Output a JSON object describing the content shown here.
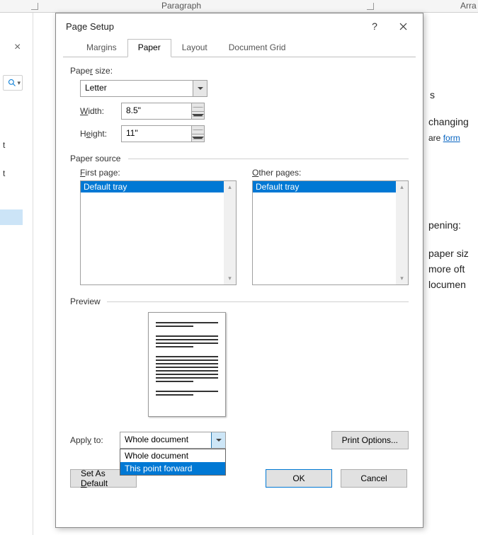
{
  "background": {
    "ribbon_group_paragraph": "Paragraph",
    "ribbon_group_arrange": "Arra",
    "pane_item_1": "t",
    "pane_item_2": "t",
    "doc_text_1": "s",
    "doc_text_2": "changing",
    "doc_text_3_plain": "are ",
    "doc_text_3_link": "form",
    "doc_text_4": "pening:",
    "doc_text_5": "paper siz",
    "doc_text_6": "more oft",
    "doc_text_7": "locumen"
  },
  "dialog": {
    "title": "Page Setup",
    "tabs": {
      "margins": "Margins",
      "paper": "Paper",
      "layout": "Layout",
      "grid": "Document Grid"
    },
    "paper_size_label": "Paper size:",
    "paper_size_value": "Letter",
    "width_label": "Width:",
    "width_value": "8.5\"",
    "height_label": "Height:",
    "height_value": "11\"",
    "paper_source_label": "Paper source",
    "first_page_label": "First page:",
    "other_pages_label": "Other pages:",
    "tray_option": "Default tray",
    "preview_label": "Preview",
    "apply_to_label": "Apply to:",
    "apply_to_value": "Whole document",
    "apply_options": [
      "Whole document",
      "This point forward"
    ],
    "apply_selected_index": 1,
    "print_options_label": "Print Options...",
    "set_default_label": "Set As Default",
    "ok_label": "OK",
    "cancel_label": "Cancel"
  }
}
